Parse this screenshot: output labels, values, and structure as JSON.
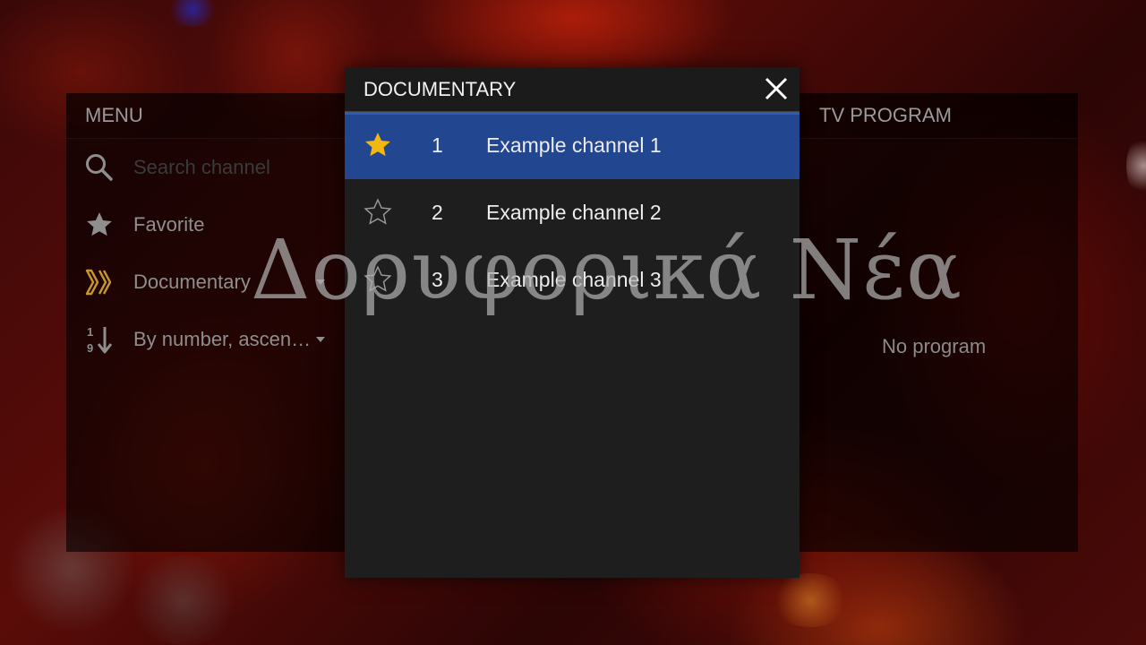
{
  "menu": {
    "title": "MENU",
    "search_placeholder": "Search channel",
    "favorite_label": "Favorite",
    "category_label": "Documentary",
    "sort_label": "By number, ascen…",
    "sort_icon_digits": [
      "1",
      "9"
    ]
  },
  "dialog": {
    "title": "DOCUMENTARY",
    "channels": [
      {
        "number": "1",
        "name": "Example channel 1",
        "favorite": true,
        "selected": true
      },
      {
        "number": "2",
        "name": "Example channel 2",
        "favorite": false,
        "selected": false
      },
      {
        "number": "3",
        "name": "Example channel 3",
        "favorite": false,
        "selected": false
      }
    ]
  },
  "program": {
    "title": "TV PROGRAM",
    "empty_text": "No program"
  },
  "watermark": {
    "text": "Δορυφορικά Νέα"
  },
  "colors": {
    "selected_row": "#234691",
    "favorite_star": "#f2b80f",
    "category_icon": "#c9962b"
  },
  "icons": {
    "search": "search-icon",
    "favorite": "star-icon",
    "category": "category-chevrons-icon",
    "sort": "sort-numeric-icon",
    "close": "close-icon"
  }
}
